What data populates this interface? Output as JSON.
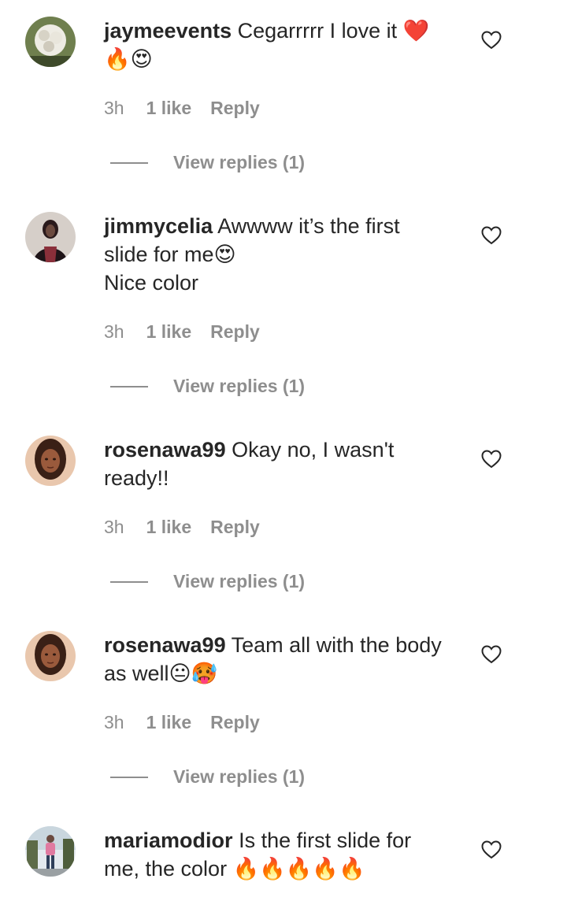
{
  "comments": [
    {
      "username": "jaymeevents",
      "text_line1": "Cegarrrrr I love it ❤️",
      "text_line2": "🔥😍",
      "text_line3": "",
      "time": "3h",
      "likes": "1 like",
      "reply_label": "Reply",
      "view_replies": "View replies (1)",
      "avatar_colors": [
        "#f2f0ea",
        "#5a6b3e",
        "#d8d4c8"
      ]
    },
    {
      "username": "jimmycelia",
      "text_line1": "Awwww it’s the first",
      "text_line2": "slide for me😍",
      "text_line3": "Nice color",
      "time": "3h",
      "likes": "1 like",
      "reply_label": "Reply",
      "view_replies": "View replies (1)",
      "avatar_colors": [
        "#cfc6c0",
        "#2a1a22",
        "#8a2f3a"
      ]
    },
    {
      "username": "rosenawa99",
      "text_line1": "Okay no, I wasn't",
      "text_line2": "ready!!",
      "text_line3": "",
      "time": "3h",
      "likes": "1 like",
      "reply_label": "Reply",
      "view_replies": "View replies (1)",
      "avatar_colors": [
        "#e8c3a8",
        "#6b3a26",
        "#2b1710"
      ]
    },
    {
      "username": "rosenawa99",
      "text_line1": "Team all with the body",
      "text_line2": "as well😐🥵",
      "text_line3": "",
      "time": "3h",
      "likes": "1 like",
      "reply_label": "Reply",
      "view_replies": "View replies (1)",
      "avatar_colors": [
        "#e8c3a8",
        "#6b3a26",
        "#2b1710"
      ]
    },
    {
      "username": "mariamodior",
      "text_line1": "Is the first slide for",
      "text_line2": "me, the color 🔥🔥🔥🔥🔥",
      "text_line3": "",
      "time": "",
      "likes": "",
      "reply_label": "",
      "view_replies": "",
      "avatar_colors": [
        "#dfe6ec",
        "#4b5a3a",
        "#e07aa0"
      ]
    }
  ],
  "icons": {
    "heart": "heart-outline-icon"
  },
  "colors": {
    "text": "#262626",
    "secondary": "#8e8e8e",
    "background": "#ffffff"
  }
}
